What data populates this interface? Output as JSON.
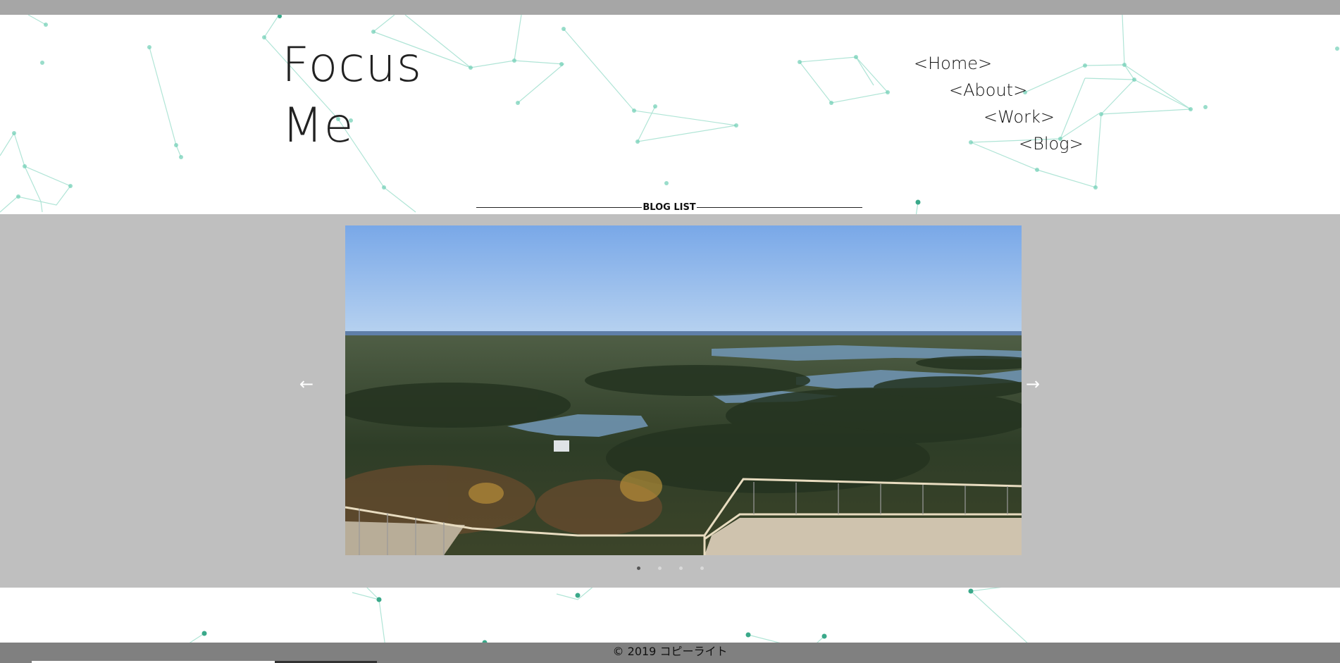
{
  "logo": {
    "line1": "Focus",
    "line2": "Me"
  },
  "nav": {
    "items": [
      {
        "label": "<Home>"
      },
      {
        "label": "<About>"
      },
      {
        "label": "<Work>"
      },
      {
        "label": "<Blog>"
      }
    ]
  },
  "blog": {
    "section_title": "BLOG LIST"
  },
  "gallery": {
    "prev_glyph": "←",
    "next_glyph": "→",
    "slide_count": 4,
    "active_slide": 1,
    "background": "#bfbfbf"
  },
  "footer": {
    "copyright": "© 2019 コピーライト"
  },
  "colors": {
    "top_bar": "#a6a6a6",
    "network": "#5ec4a8",
    "footer_bar": "#808080"
  }
}
